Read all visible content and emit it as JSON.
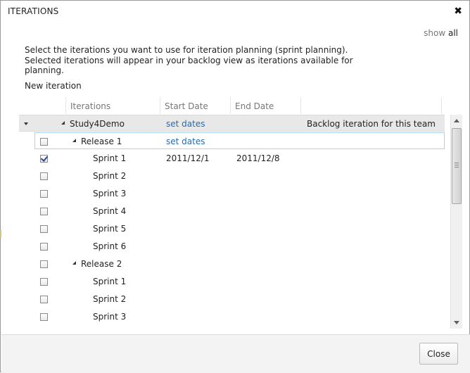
{
  "dialog": {
    "title": "ITERATIONS",
    "show_prefix": "show",
    "show_all": "all",
    "description": "Select the iterations you want to use for iteration planning (sprint planning).  Selected iterations will appear in your backlog view as iterations available for planning.",
    "new_iteration": "New iteration",
    "close_label": "Close"
  },
  "grid": {
    "headers": [
      "Iterations",
      "Start Date",
      "End Date",
      ""
    ],
    "rows": [
      {
        "name": "Study4Demo",
        "start": "set dates",
        "end": "",
        "note": "Backlog iteration for this team",
        "level": 0,
        "checkbox": false,
        "checked": false,
        "expanded": true
      },
      {
        "name": "Release 1",
        "start": "set dates",
        "end": "",
        "note": "",
        "level": 1,
        "checkbox": true,
        "checked": false,
        "expanded": true
      },
      {
        "name": "Sprint 1",
        "start": "2011/12/1",
        "end": "2011/12/8",
        "note": "",
        "level": 2,
        "checkbox": true,
        "checked": true
      },
      {
        "name": "Sprint 2",
        "start": "",
        "end": "",
        "note": "",
        "level": 2,
        "checkbox": true,
        "checked": false
      },
      {
        "name": "Sprint 3",
        "start": "",
        "end": "",
        "note": "",
        "level": 2,
        "checkbox": true,
        "checked": false
      },
      {
        "name": "Sprint 4",
        "start": "",
        "end": "",
        "note": "",
        "level": 2,
        "checkbox": true,
        "checked": false
      },
      {
        "name": "Sprint 5",
        "start": "",
        "end": "",
        "note": "",
        "level": 2,
        "checkbox": true,
        "checked": false
      },
      {
        "name": "Sprint 6",
        "start": "",
        "end": "",
        "note": "",
        "level": 2,
        "checkbox": true,
        "checked": false
      },
      {
        "name": "Release 2",
        "start": "",
        "end": "",
        "note": "",
        "level": 1,
        "checkbox": true,
        "checked": false,
        "expanded": true
      },
      {
        "name": "Sprint 1",
        "start": "",
        "end": "",
        "note": "",
        "level": 2,
        "checkbox": true,
        "checked": false
      },
      {
        "name": "Sprint 2",
        "start": "",
        "end": "",
        "note": "",
        "level": 2,
        "checkbox": true,
        "checked": false
      },
      {
        "name": "Sprint 3",
        "start": "",
        "end": "",
        "note": "",
        "level": 2,
        "checkbox": true,
        "checked": false
      }
    ]
  },
  "icons": {
    "close": "close-icon",
    "collapse": "collapse-all-icon",
    "expander": "expanded-triangle-icon",
    "checkbox": "checkbox-icon"
  },
  "colors": {
    "link": "#1f6db5",
    "selected_border": "#a9d3ef",
    "top_row_bg": "#e8e8e8"
  }
}
